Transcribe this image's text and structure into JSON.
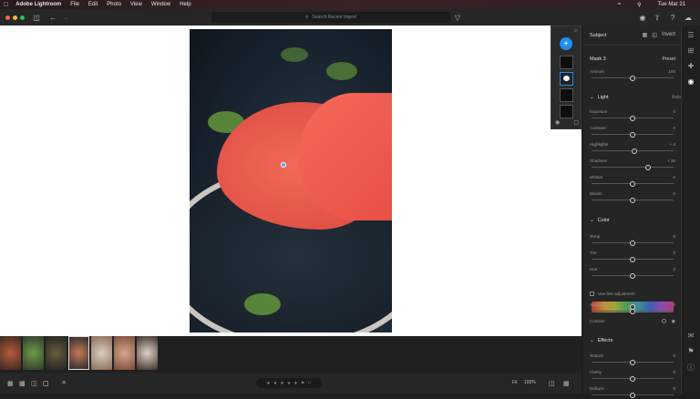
{
  "menubar": {
    "apple": "",
    "app_name": "Adobe Lightroom",
    "menus": [
      "File",
      "Edit",
      "Photo",
      "View",
      "Window",
      "Help"
    ],
    "clock": "Tue Mar 21"
  },
  "toolbar": {
    "search_placeholder": "Search Recent Import"
  },
  "panel": {
    "title": "Subject",
    "invert_label": "Invert",
    "mask_name": "Mask 3",
    "preset_label": "Preset",
    "amount_label": "Amount",
    "amount_value": "100",
    "amount_level": 0.5,
    "light": {
      "title": "Light",
      "auto": "Auto",
      "sliders": [
        {
          "label": "Exposure",
          "value": "0",
          "level": 0.5
        },
        {
          "label": "Contrast",
          "value": "0",
          "level": 0.5
        },
        {
          "label": "Highlights",
          "value": "+ 4",
          "level": 0.52
        },
        {
          "label": "Shadows",
          "value": "+ 38",
          "level": 0.69
        },
        {
          "label": "Whites",
          "value": "0",
          "level": 0.5
        },
        {
          "label": "Blacks",
          "value": "0",
          "level": 0.5
        }
      ]
    },
    "color": {
      "title": "Color",
      "sliders": [
        {
          "label": "Temp",
          "value": "0",
          "level": 0.5
        },
        {
          "label": "Tint",
          "value": "0",
          "level": 0.5
        },
        {
          "label": "Hue",
          "value": "0",
          "level": 0.5
        }
      ],
      "fine_adjust_label": "Use fine adjustment",
      "saturation": {
        "label": "Saturation",
        "value": "0",
        "level": 0.5
      },
      "colorize_label": "Colorize"
    },
    "effects": {
      "title": "Effects",
      "sliders": [
        {
          "label": "Texture",
          "value": "0",
          "level": 0.5
        },
        {
          "label": "Clarity",
          "value": "0",
          "level": 0.5
        },
        {
          "label": "Dehaze",
          "value": "0",
          "level": 0.5
        }
      ]
    }
  },
  "bottombar": {
    "fit_label": "Fit",
    "zoom_label": "100%"
  },
  "colors": {
    "accent": "#1f8ef1",
    "mask_overlay": "#e5574b"
  }
}
